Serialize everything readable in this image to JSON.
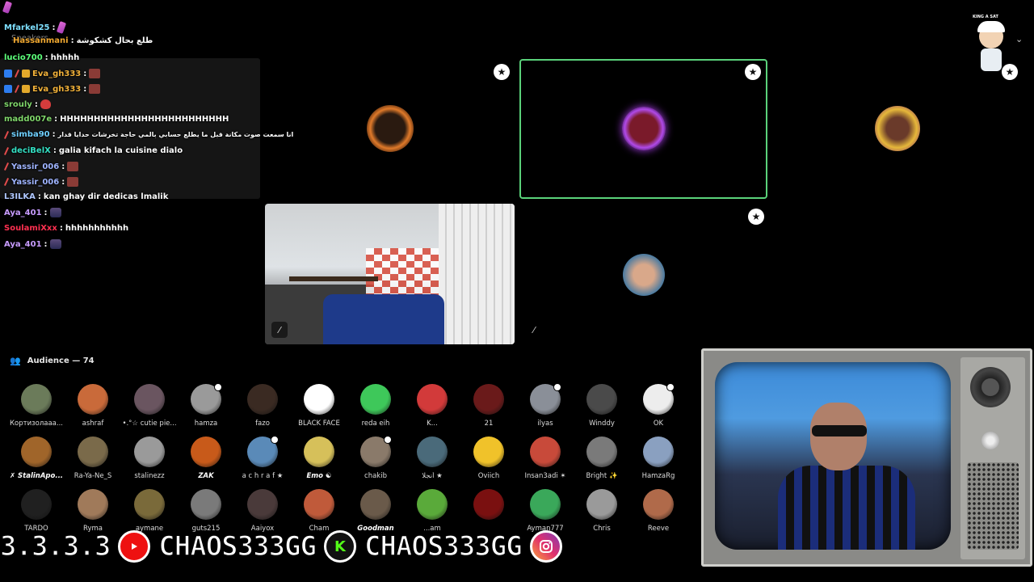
{
  "chat": {
    "ghost_label": "Speakers",
    "lines": [
      {
        "user": "Mfarkel25",
        "color": "#7ee0ff",
        "msg": ""
      },
      {
        "user": "Hassanmani",
        "color": "#f0a830",
        "msg": "طلع بحال كشكوشة"
      },
      {
        "user": "lucio700",
        "color": "#5cff7a",
        "msg": "hhhhh"
      },
      {
        "user": "Eva_gh333",
        "color": "#f2b23a",
        "msg": ""
      },
      {
        "user": "Eva_gh333",
        "color": "#f2b23a",
        "msg": ""
      },
      {
        "user": "srouly",
        "color": "#7fd66a",
        "msg": ""
      },
      {
        "user": "madd007e",
        "color": "#7fd66a",
        "msg": "HHHHHHHHHHHHHHHHHHHHHHHHH"
      },
      {
        "user": "simba90",
        "color": "#6fd0ff",
        "msg": "انا سمعت صوت مكانة قبل ما يطلع حسابي بالمي حاجة تخرشات حدايا قدار"
      },
      {
        "user": "deciBelX",
        "color": "#34e0c4",
        "msg": "galia kifach la cuisine dialo"
      },
      {
        "user": "Yassir_006",
        "color": "#9fb4ff",
        "msg": ""
      },
      {
        "user": "Yassir_006",
        "color": "#9fb4ff",
        "msg": ""
      },
      {
        "user": "L3ILKA",
        "color": "#b0c8ff",
        "msg": "kan ghay dir dedicas lmalik"
      },
      {
        "user": "Aya_401",
        "color": "#c89cff",
        "msg": ""
      },
      {
        "user": "SoulamiXxx",
        "color": "#ff3050",
        "msg": "hhhhhhhhhhh"
      },
      {
        "user": "Aya_401",
        "color": "#c89cff",
        "msg": ""
      }
    ]
  },
  "stage": {
    "tiles": [
      {
        "bg": "#140f0d",
        "avatar_bg": "#e07a2a",
        "speaking": false
      },
      {
        "bg": "#1a1b1f",
        "avatar_bg": "#9b3be0",
        "speaking": true
      },
      {
        "bg": "#a35a57",
        "avatar_bg": "#e6b83a",
        "speaking": false
      },
      {
        "bg": "#565c44",
        "avatar_bg": "#2c5a7a",
        "speaking": false
      }
    ],
    "speaking_border_color": "#5ad27a",
    "star_glyph": "★",
    "mute_glyph": "⁄"
  },
  "mascot": {
    "tag": "KING A SAT"
  },
  "audience": {
    "title": "Audience — 74",
    "icon": "people-icon",
    "rows": [
      [
        {
          "name": "Кортизолааа...",
          "color": "#6b7b5a"
        },
        {
          "name": "ashraf",
          "color": "#c96a3a"
        },
        {
          "name": "•.°☆ cutie pie...",
          "color": "#6a5560"
        },
        {
          "name": "hamza",
          "color": "#9a9a9a",
          "dot": true
        },
        {
          "name": "fazo",
          "color": "#3a2a22"
        },
        {
          "name": "BLACK FACE",
          "color": "#ffffff"
        },
        {
          "name": "reda eih",
          "color": "#3ec85a"
        },
        {
          "name": "K...",
          "color": "#d23a3a"
        },
        {
          "name": "21",
          "color": "#6a1a1a"
        },
        {
          "name": "ilyas",
          "color": "#8a8f98",
          "dot": true
        },
        {
          "name": "Winddy",
          "color": "#4a4a4a"
        },
        {
          "name": "OK",
          "color": "#ededed",
          "dot": true
        }
      ],
      [
        {
          "name": "✗ StalinApo...",
          "color": "#a0652a",
          "strong": true
        },
        {
          "name": "Ra-Ya-Ne_S",
          "color": "#7a6a4a"
        },
        {
          "name": "stalinezz",
          "color": "#9a9a9a"
        },
        {
          "name": "ZAK",
          "color": "#c85a1a",
          "strong": true
        },
        {
          "name": "a c h r a f ★",
          "color": "#5a8ab8",
          "dot": true
        },
        {
          "name": "Emo ☯",
          "color": "#d6c05a",
          "strong": true
        },
        {
          "name": "chakib",
          "color": "#8a7a6a",
          "dot": true
        },
        {
          "name": "أنجلا ★",
          "color": "#4a6a7a"
        },
        {
          "name": "Oviich",
          "color": "#f0c22a"
        },
        {
          "name": "Insan3adi ✶",
          "color": "#c84a3a"
        },
        {
          "name": "Bright ✨",
          "color": "#7a7a7a"
        },
        {
          "name": "HamzaRg",
          "color": "#8aa0c0"
        }
      ],
      [
        {
          "name": "TARDO",
          "color": "#202020"
        },
        {
          "name": "Ryma",
          "color": "#a07a5a"
        },
        {
          "name": "aymane",
          "color": "#7a6a3a"
        },
        {
          "name": "guts215",
          "color": "#7a7a7a"
        },
        {
          "name": "Aaiyox",
          "color": "#4a3a3a"
        },
        {
          "name": "Cham",
          "color": "#c05a3a"
        },
        {
          "name": "Goodman",
          "color": "#6a5a4a",
          "strong": true
        },
        {
          "name": "...am",
          "color": "#5aaa3a"
        },
        {
          "name": "",
          "color": "#7a1010"
        },
        {
          "name": "Ayman777",
          "color": "#3aa85a"
        },
        {
          "name": "Chris",
          "color": "#9a9a9a"
        },
        {
          "name": "Reeve",
          "color": "#b06a4a"
        }
      ]
    ]
  },
  "banner": {
    "text_left": "3.3.3.3",
    "text_mid": "CHAOS333GG",
    "text_right": "CHAOS333GG",
    "youtube_icon": "youtube-icon",
    "kick_icon": "kick-icon",
    "instagram_icon": "instagram-icon"
  }
}
